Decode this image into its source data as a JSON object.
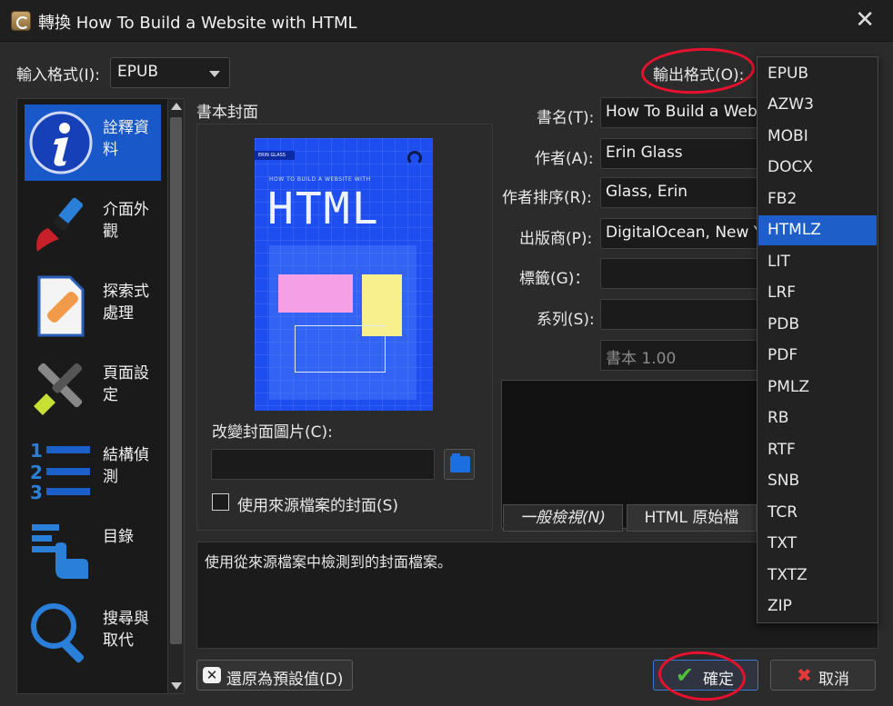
{
  "window": {
    "title": "轉換 How To Build a Website with HTML",
    "close_glyph": "✕"
  },
  "input_format": {
    "label": "輸入格式(I):",
    "value": "EPUB"
  },
  "output_format": {
    "label": "輸出格式(O):",
    "options": [
      "EPUB",
      "AZW3",
      "MOBI",
      "DOCX",
      "FB2",
      "HTMLZ",
      "LIT",
      "LRF",
      "PDB",
      "PDF",
      "PMLZ",
      "RB",
      "RTF",
      "SNB",
      "TCR",
      "TXT",
      "TXTZ",
      "ZIP"
    ],
    "selected": "HTMLZ"
  },
  "sidebar": {
    "items": [
      {
        "label": "詮釋資料",
        "icon": "info-icon"
      },
      {
        "label": "介面外觀",
        "icon": "paintbrush-icon"
      },
      {
        "label": "探索式處理",
        "icon": "bandage-document-icon"
      },
      {
        "label": "頁面設定",
        "icon": "wrench-screwdriver-icon"
      },
      {
        "label": "結構偵測",
        "icon": "numbered-list-icon"
      },
      {
        "label": "目錄",
        "icon": "toc-icon"
      },
      {
        "label": "搜尋與取代",
        "icon": "magnifier-icon"
      }
    ],
    "active_index": 0
  },
  "cover": {
    "heading": "書本封面",
    "image": {
      "author_tag": "ERIN GLASS",
      "subtitle": "HOW TO BUILD A WEBSITE WITH",
      "title": "HTML"
    },
    "change_label": "改變封面圖片(C):",
    "path_value": "",
    "use_source_label": "使用來源檔案的封面(S)",
    "use_source_checked": false
  },
  "metadata": {
    "title": {
      "label": "書名(T):",
      "value": "How To Build a Website with HTML"
    },
    "authors": {
      "label": "作者(A):",
      "value": "Erin Glass"
    },
    "author_sort": {
      "label": "作者排序(R):",
      "value": "Glass, Erin"
    },
    "publisher": {
      "label": "出版商(P):",
      "value": "DigitalOcean, New York City, New York, USA"
    },
    "tags": {
      "label": "標籤(G)：",
      "value": ""
    },
    "series": {
      "label": "系列(S):",
      "value": ""
    },
    "series_index": {
      "value": "書本 1.00"
    }
  },
  "preview_tabs": [
    "一般檢視(N)",
    "HTML 原始檔"
  ],
  "description": "使用從來源檔案中檢測到的封面檔案。",
  "buttons": {
    "restore": "還原為預設值(D)",
    "ok": "確定",
    "cancel": "取消"
  },
  "colors": {
    "accent": "#1d5ec9",
    "annotation": "#e8112d",
    "cover_blue": "#1e4ef0"
  }
}
